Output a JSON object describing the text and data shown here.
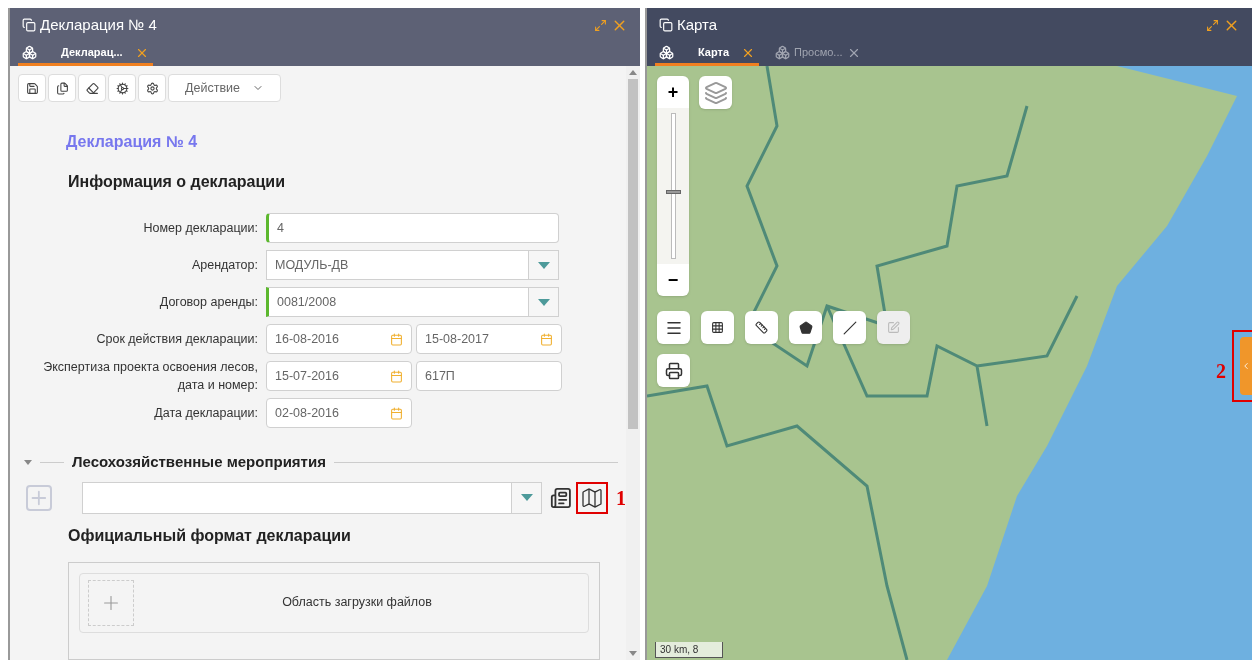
{
  "left_window": {
    "title": "Декларация № 4",
    "tabs": [
      {
        "label": "Декларац...",
        "selected": true
      }
    ],
    "toolbar": {
      "action_button": "Действие"
    },
    "heading": "Декларация № 4",
    "section_title": "Информация о декларации",
    "fields": [
      {
        "kind": "text",
        "label": "Номер декларации:",
        "values": [
          "4"
        ],
        "required": true
      },
      {
        "kind": "select",
        "label": "Арендатор:",
        "values": [
          "МОДУЛЬ-ДВ"
        ],
        "required": false
      },
      {
        "kind": "select",
        "label": "Договор аренды:",
        "values": [
          "0081/2008"
        ],
        "required": true
      },
      {
        "kind": "date_pair",
        "label": "Срок действия декларации:",
        "values": [
          "16-08-2016",
          "15-08-2017"
        ],
        "required": false
      },
      {
        "kind": "date_text",
        "label": "Экспертиза проекта освоения лесов, дата и номер:",
        "values": [
          "15-07-2016",
          "617П"
        ],
        "required": false
      },
      {
        "kind": "date",
        "label": "Дата декларации:",
        "values": [
          "02-08-2016"
        ],
        "required": false
      }
    ],
    "forest_section": {
      "title": "Лесохозяйственные мероприятия",
      "expanded": true,
      "annotation": "1"
    },
    "format_section": {
      "title": "Официальный формат декларации",
      "upload_label": "Область загрузки файлов"
    }
  },
  "right_window": {
    "title": "Карта",
    "tabs": [
      {
        "label": "Карта",
        "selected": true
      },
      {
        "label": "Просмо...",
        "selected": false
      }
    ],
    "zoom": {
      "plus": "+",
      "minus": "−",
      "level": 0.46
    },
    "scale": "30 km, 8",
    "annotation": "2"
  }
}
